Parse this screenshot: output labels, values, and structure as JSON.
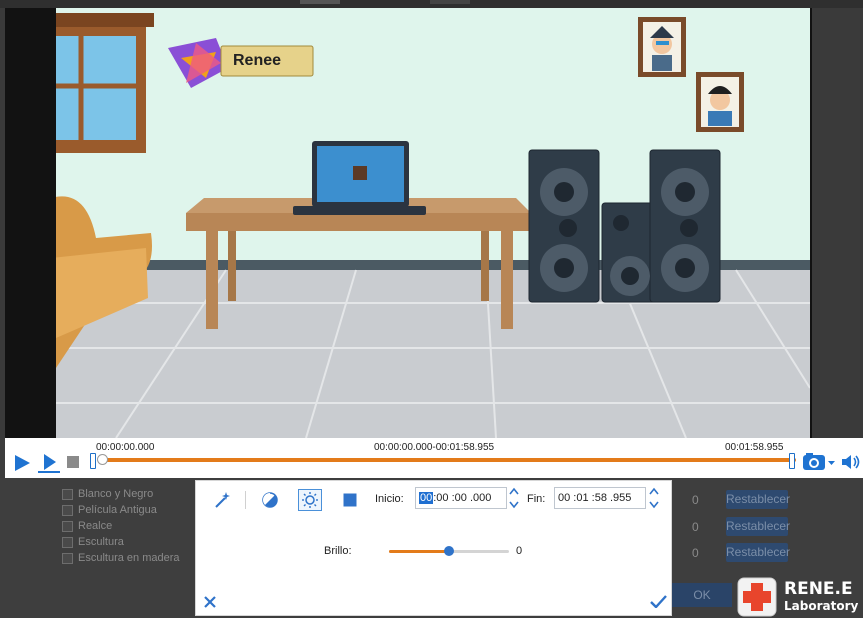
{
  "player": {
    "time_start": "00:00:00.000",
    "time_range": "00:00:00.000-00:01:58.955",
    "time_end": "00:01:58.955",
    "progress_fraction": 0.0
  },
  "video": {
    "brand_label": "Renee"
  },
  "effects_list": {
    "items": [
      {
        "label": "Blanco y Negro"
      },
      {
        "label": "Película Antigua"
      },
      {
        "label": "Realce"
      },
      {
        "label": "Escultura"
      },
      {
        "label": "Escultura en madera"
      }
    ],
    "values": [
      "0",
      "0",
      "0"
    ],
    "reset_label": "Restablecer",
    "ok_label": "OK"
  },
  "dialog": {
    "start_label": "Inicio:",
    "start_value_hl": "00",
    "start_value_rest": " :00 :00 .000",
    "end_label": "Fin:",
    "end_value": "00 :01 :58 .955",
    "brightness_label": "Brillo:",
    "brightness_value": "0",
    "brightness_fraction": 0.5
  },
  "logo": {
    "line1": "RENE.E",
    "line2": "Laboratory"
  },
  "colors": {
    "accent_orange": "#e37b1a",
    "accent_blue": "#2f73c9",
    "logo_red": "#e8452c"
  }
}
